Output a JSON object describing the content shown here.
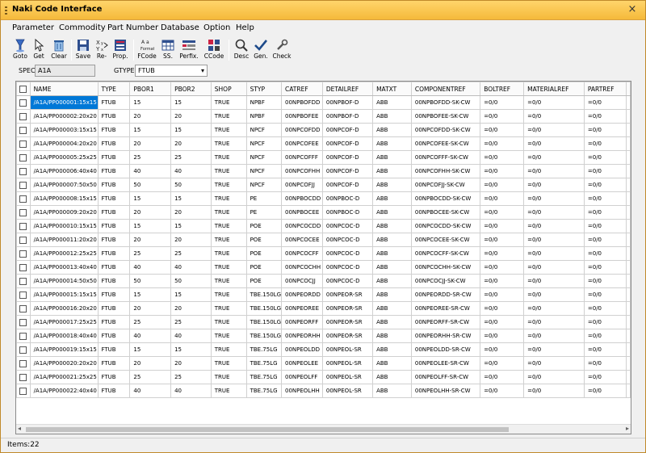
{
  "window": {
    "title": "Naki Code Interface",
    "close": "×"
  },
  "menu": [
    "Parameter",
    "Commodity",
    "Part Number",
    "Database",
    "Option",
    "Help"
  ],
  "toolbar": {
    "goto": "Goto",
    "get": "Get",
    "clear": "Clear",
    "save": "Save",
    "re": "Re-",
    "prop": "Prop.",
    "fcode": "FCode",
    "ss": "SS.",
    "perfix": "Perfix.",
    "ccode": "CCode",
    "desc": "Desc",
    "gen": "Gen.",
    "check": "Check"
  },
  "filters": {
    "spec_label": "SPEC",
    "spec_value": "A1A",
    "gtype_label": "GTYPE",
    "gtype_value": "FTUB"
  },
  "table": {
    "columns": [
      "NAME",
      "TYPE",
      "PBOR1",
      "PBOR2",
      "SHOP",
      "STYP",
      "CATREF",
      "DETAILREF",
      "MATXT",
      "COMPONENTREF",
      "BOLTREF",
      "MATERIALREF",
      "PARTREF"
    ],
    "rows": [
      [
        "/A1A/PP000001:15x15",
        "FTUB",
        "15",
        "15",
        "TRUE",
        "NPBF",
        "00NPBOFDD",
        "00NPBOF-D",
        "ABB",
        "00NPBOFDD-SK-CW",
        "=0/0",
        "=0/0",
        "=0/0"
      ],
      [
        "/A1A/PP000002:20x20",
        "FTUB",
        "20",
        "20",
        "TRUE",
        "NPBF",
        "00NPBOFEE",
        "00NPBOF-D",
        "ABB",
        "00NPBOFEE-SK-CW",
        "=0/0",
        "=0/0",
        "=0/0"
      ],
      [
        "/A1A/PP000003:15x15",
        "FTUB",
        "15",
        "15",
        "TRUE",
        "NPCF",
        "00NPCOFDD",
        "00NPCOF-D",
        "ABB",
        "00NPCOFDD-SK-CW",
        "=0/0",
        "=0/0",
        "=0/0"
      ],
      [
        "/A1A/PP000004:20x20",
        "FTUB",
        "20",
        "20",
        "TRUE",
        "NPCF",
        "00NPCOFEE",
        "00NPCOF-D",
        "ABB",
        "00NPCOFEE-SK-CW",
        "=0/0",
        "=0/0",
        "=0/0"
      ],
      [
        "/A1A/PP000005:25x25",
        "FTUB",
        "25",
        "25",
        "TRUE",
        "NPCF",
        "00NPCOFFF",
        "00NPCOF-D",
        "ABB",
        "00NPCOFFF-SK-CW",
        "=0/0",
        "=0/0",
        "=0/0"
      ],
      [
        "/A1A/PP000006:40x40",
        "FTUB",
        "40",
        "40",
        "TRUE",
        "NPCF",
        "00NPCOFHH",
        "00NPCOF-D",
        "ABB",
        "00NPCOFHH-SK-CW",
        "=0/0",
        "=0/0",
        "=0/0"
      ],
      [
        "/A1A/PP000007:50x50",
        "FTUB",
        "50",
        "50",
        "TRUE",
        "NPCF",
        "00NPCOFJJ",
        "00NPCOF-D",
        "ABB",
        "00NPCOFJJ-SK-CW",
        "=0/0",
        "=0/0",
        "=0/0"
      ],
      [
        "/A1A/PP000008:15x15",
        "FTUB",
        "15",
        "15",
        "TRUE",
        "PE",
        "00NPBOCDD",
        "00NPBOC-D",
        "ABB",
        "00NPBOCDD-SK-CW",
        "=0/0",
        "=0/0",
        "=0/0"
      ],
      [
        "/A1A/PP000009:20x20",
        "FTUB",
        "20",
        "20",
        "TRUE",
        "PE",
        "00NPBOCEE",
        "00NPBOC-D",
        "ABB",
        "00NPBOCEE-SK-CW",
        "=0/0",
        "=0/0",
        "=0/0"
      ],
      [
        "/A1A/PP000010:15x15",
        "FTUB",
        "15",
        "15",
        "TRUE",
        "POE",
        "00NPCOCDD",
        "00NPCOC-D",
        "ABB",
        "00NPCOCDD-SK-CW",
        "=0/0",
        "=0/0",
        "=0/0"
      ],
      [
        "/A1A/PP000011:20x20",
        "FTUB",
        "20",
        "20",
        "TRUE",
        "POE",
        "00NPCOCEE",
        "00NPCOC-D",
        "ABB",
        "00NPCOCEE-SK-CW",
        "=0/0",
        "=0/0",
        "=0/0"
      ],
      [
        "/A1A/PP000012:25x25",
        "FTUB",
        "25",
        "25",
        "TRUE",
        "POE",
        "00NPCOCFF",
        "00NPCOC-D",
        "ABB",
        "00NPCOCFF-SK-CW",
        "=0/0",
        "=0/0",
        "=0/0"
      ],
      [
        "/A1A/PP000013:40x40",
        "FTUB",
        "40",
        "40",
        "TRUE",
        "POE",
        "00NPCOCHH",
        "00NPCOC-D",
        "ABB",
        "00NPCOCHH-SK-CW",
        "=0/0",
        "=0/0",
        "=0/0"
      ],
      [
        "/A1A/PP000014:50x50",
        "FTUB",
        "50",
        "50",
        "TRUE",
        "POE",
        "00NPCOCJJ",
        "00NPCOC-D",
        "ABB",
        "00NPCOCJJ-SK-CW",
        "=0/0",
        "=0/0",
        "=0/0"
      ],
      [
        "/A1A/PP000015:15x15",
        "FTUB",
        "15",
        "15",
        "TRUE",
        "TBE.150LG",
        "00NPEORDD",
        "00NPEOR-SR",
        "ABB",
        "00NPEORDD-SR-CW",
        "=0/0",
        "=0/0",
        "=0/0"
      ],
      [
        "/A1A/PP000016:20x20",
        "FTUB",
        "20",
        "20",
        "TRUE",
        "TBE.150LG",
        "00NPEOREE",
        "00NPEOR-SR",
        "ABB",
        "00NPEOREE-SR-CW",
        "=0/0",
        "=0/0",
        "=0/0"
      ],
      [
        "/A1A/PP000017:25x25",
        "FTUB",
        "25",
        "25",
        "TRUE",
        "TBE.150LG",
        "00NPEORFF",
        "00NPEOR-SR",
        "ABB",
        "00NPEORFF-SR-CW",
        "=0/0",
        "=0/0",
        "=0/0"
      ],
      [
        "/A1A/PP000018:40x40",
        "FTUB",
        "40",
        "40",
        "TRUE",
        "TBE.150LG",
        "00NPEORHH",
        "00NPEOR-SR",
        "ABB",
        "00NPEORHH-SR-CW",
        "=0/0",
        "=0/0",
        "=0/0"
      ],
      [
        "/A1A/PP000019:15x15",
        "FTUB",
        "15",
        "15",
        "TRUE",
        "TBE.75LG",
        "00NPEOLDD",
        "00NPEOL-SR",
        "ABB",
        "00NPEOLDD-SR-CW",
        "=0/0",
        "=0/0",
        "=0/0"
      ],
      [
        "/A1A/PP000020:20x20",
        "FTUB",
        "20",
        "20",
        "TRUE",
        "TBE.75LG",
        "00NPEOLEE",
        "00NPEOL-SR",
        "ABB",
        "00NPEOLEE-SR-CW",
        "=0/0",
        "=0/0",
        "=0/0"
      ],
      [
        "/A1A/PP000021:25x25",
        "FTUB",
        "25",
        "25",
        "TRUE",
        "TBE.75LG",
        "00NPEOLFF",
        "00NPEOL-SR",
        "ABB",
        "00NPEOLFF-SR-CW",
        "=0/0",
        "=0/0",
        "=0/0"
      ],
      [
        "/A1A/PP000022:40x40",
        "FTUB",
        "40",
        "40",
        "TRUE",
        "TBE.75LG",
        "00NPEOLHH",
        "00NPEOL-SR",
        "ABB",
        "00NPEOLHH-SR-CW",
        "=0/0",
        "=0/0",
        "=0/0"
      ]
    ]
  },
  "status": {
    "text": "Items:22"
  },
  "colors": {
    "title_bar": "#f5b93a",
    "selection": "#0078d7"
  }
}
